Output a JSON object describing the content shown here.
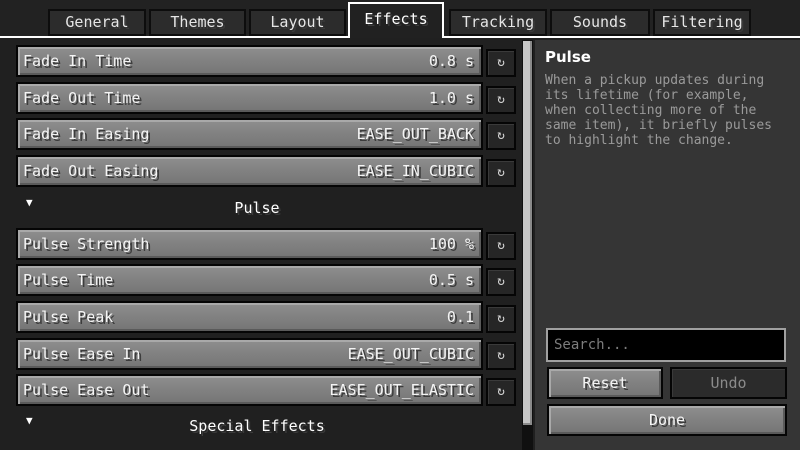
{
  "tabs": [
    {
      "label": "General"
    },
    {
      "label": "Themes"
    },
    {
      "label": "Layout"
    },
    {
      "label": "Effects",
      "active": true
    },
    {
      "label": "Tracking"
    },
    {
      "label": "Sounds"
    },
    {
      "label": "Filtering"
    }
  ],
  "reset_icon": "↻",
  "settings": {
    "fade_in_time": {
      "label": "Fade In Time",
      "value": "0.8 s"
    },
    "fade_out_time": {
      "label": "Fade Out Time",
      "value": "1.0 s"
    },
    "fade_in_easing": {
      "label": "Fade In Easing",
      "value": "EASE_OUT_BACK"
    },
    "fade_out_easing": {
      "label": "Fade Out Easing",
      "value": "EASE_IN_CUBIC"
    },
    "pulse_strength": {
      "label": "Pulse Strength",
      "value": "100 %"
    },
    "pulse_time": {
      "label": "Pulse Time",
      "value": "0.5 s"
    },
    "pulse_peak": {
      "label": "Pulse Peak",
      "value": "0.1"
    },
    "pulse_ease_in": {
      "label": "Pulse Ease In",
      "value": "EASE_OUT_CUBIC"
    },
    "pulse_ease_out": {
      "label": "Pulse Ease Out",
      "value": "EASE_OUT_ELASTIC"
    }
  },
  "sections": {
    "pulse": {
      "title": "Pulse",
      "arrow": "▼"
    },
    "special_effects": {
      "title": "Special Effects",
      "arrow": "▼"
    }
  },
  "info": {
    "title": "Pulse",
    "description": "When a pickup updates during its lifetime (for example, when collecting more of the same item), it briefly pulses to highlight the change."
  },
  "search": {
    "placeholder": "Search...",
    "value": ""
  },
  "buttons": {
    "reset": "Reset",
    "undo": "Undo",
    "done": "Done"
  }
}
